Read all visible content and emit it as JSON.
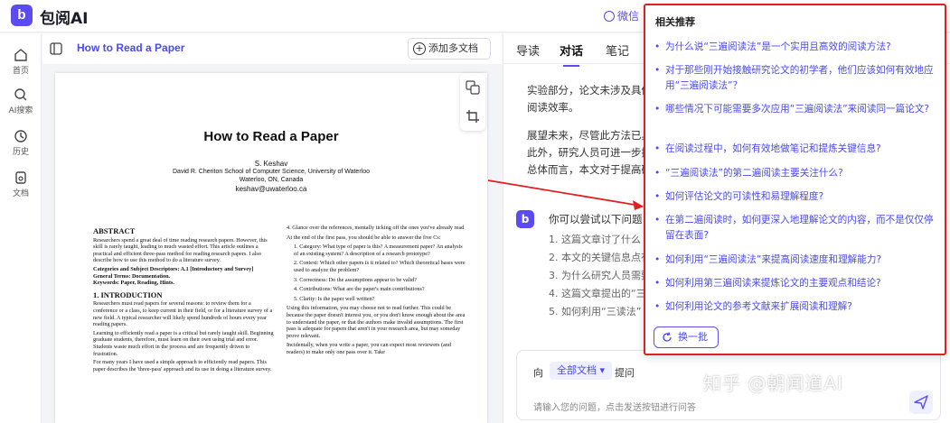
{
  "app": {
    "logo_letter": "b",
    "name": "包阅AI",
    "wechat_label": "微信"
  },
  "leftnav": [
    {
      "label": "首页",
      "icon": "home-icon"
    },
    {
      "label": "AI搜索",
      "icon": "ai-search-icon"
    },
    {
      "label": "历史",
      "icon": "clock-icon"
    },
    {
      "label": "文档",
      "icon": "document-icon"
    }
  ],
  "doc": {
    "title": "How to Read a Paper",
    "add_button": "添加多文档"
  },
  "pdf": {
    "title": "How to Read a Paper",
    "author": "S. Keshav",
    "affiliation": "David R. Cheriton School of Computer Science, University of Waterloo",
    "location": "Waterloo, ON, Canada",
    "email": "keshav@uwaterloo.ca",
    "abstract_h": "ABSTRACT",
    "abstract": "Researchers spend a great deal of time reading research papers. However, this skill is rarely taught, leading to much wasted effort. This article outlines a practical and efficient three-pass method for reading research papers. I also describe how to use this method to do a literature survey.",
    "categories": "Categories and Subject Descriptors: A.1 [Introductory and Survey]",
    "general_terms": "General Terms: Documentation.",
    "keywords": "Keywords: Paper, Reading, Hints.",
    "intro_h": "1.   INTRODUCTION",
    "intro_1": "Researchers must read papers for several reasons: to review them for a conference or a class, to keep current in their field, or for a literature survey of a new field. A typical researcher will likely spend hundreds of hours every year reading papers.",
    "intro_2": "Learning to efficiently read a paper is a critical but rarely taught skill. Beginning graduate students, therefore, must learn on their own using trial and error. Students waste much effort in the process and are frequently driven to frustration.",
    "intro_3": "For many years I have used a simple approach to efficiently read papers. This paper describes the 'three-pass' approach and its use in doing a literature survey.",
    "right_1": "4. Glance over the references, mentally ticking off the ones you've already read",
    "right_2": "At the end of the first pass, you should be able to answer the five Cs:",
    "right_3": "1. Category: What type of paper is this? A measurement paper? An analysis of an existing system? A description of a research prototype?",
    "right_4": "2. Context: Which other papers is it related to? Which theoretical bases were used to analyze the problem?",
    "right_5": "3. Correctness: Do the assumptions appear to be valid?",
    "right_6": "4. Contributions: What are the paper's main contributions?",
    "right_7": "5. Clarity: Is the paper well written?",
    "right_8": "Using this information, you may choose not to read further. This could be because the paper doesn't interest you, or you don't know enough about the area to understand the paper, or that the authors make invalid assumptions. The first pass is adequate for papers that aren't in your research area, but may someday prove relevant.",
    "right_9": "Incidentally, when you write a paper, you can expect most reviewers (and readers) to make only one pass over it. Take"
  },
  "tabs": [
    "导读",
    "对话",
    "笔记"
  ],
  "answer": {
    "p1": "实验部分，论文未涉及具体",
    "p2": "阅读效率。",
    "p3": "展望未来，尽管此方法已具",
    "p4": "此外，研究人员可进一步探",
    "p5": "总体而言，本文对于提高研"
  },
  "suggest": {
    "title": "你可以尝试以下问题",
    "items": [
      "1. 这篇文章讨了什么",
      "2. 本文的关键信息点有",
      "3. 为什么研究人员需要",
      "4. 这篇文章提出的“三",
      "5. 如何利用“三读法”"
    ]
  },
  "input": {
    "prefix": "向",
    "scope": "全部文档 ▾",
    "suffix": "提问",
    "placeholder": "请输入您的问题，点击发送按钮进行问答"
  },
  "watermark": "知乎 @朝闻道AI",
  "popup": {
    "title": "相关推荐",
    "items": [
      "为什么说“三遍阅读法”是一个实用且高效的阅读方法?",
      "对于那些刚开始接触研究论文的初学者，他们应该如何有效地应用“三遍阅读法”？",
      "哪些情况下可能需要多次应用“三遍阅读法”来阅读同一篇论文?",
      "在阅读过程中，如何有效地做笔记和提炼关键信息?",
      "“三遍阅读法”的第二遍阅读主要关注什么?",
      "如何评估论文的可读性和易理解程度?",
      "在第二遍阅读时，如何更深入地理解论文的内容，而不是仅仅停留在表面?",
      "如何利用“三遍阅读法”来提高阅读速度和理解能力?",
      "如何利用第三遍阅读来提炼论文的主要观点和结论?",
      "如何利用论文的参考文献来扩展阅读和理解?"
    ],
    "refresh": "换一批"
  }
}
